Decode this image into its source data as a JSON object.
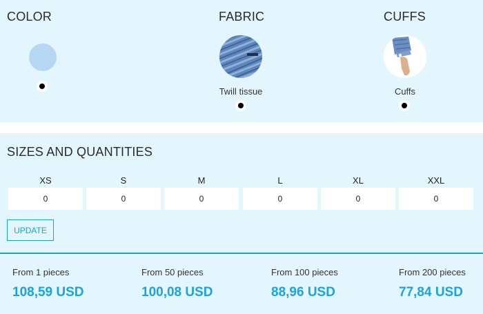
{
  "options": {
    "color": {
      "heading": "COLOR",
      "swatch_color": "#b5d7f3"
    },
    "fabric": {
      "heading": "FABRIC",
      "caption": "Twill tissue"
    },
    "cuffs": {
      "heading": "CUFFS",
      "caption": "Cuffs"
    }
  },
  "sizes": {
    "heading": "SIZES AND QUANTITIES",
    "items": [
      {
        "label": "XS",
        "qty": "0"
      },
      {
        "label": "S",
        "qty": "0"
      },
      {
        "label": "M",
        "qty": "0"
      },
      {
        "label": "L",
        "qty": "0"
      },
      {
        "label": "XL",
        "qty": "0"
      },
      {
        "label": "XXL",
        "qty": "0"
      }
    ],
    "update_label": "UPDATE"
  },
  "prices": [
    {
      "label": "From 1 pieces",
      "value": "108,59 USD"
    },
    {
      "label": "From 50 pieces",
      "value": "100,08 USD"
    },
    {
      "label": "From 100 pieces",
      "value": "88,96 USD"
    },
    {
      "label": "From 200 pieces",
      "value": "77,84 USD"
    }
  ],
  "colors": {
    "panel_bg": "#e4f6fd",
    "accent": "#1aa3c8",
    "price": "#1aa3dd"
  }
}
